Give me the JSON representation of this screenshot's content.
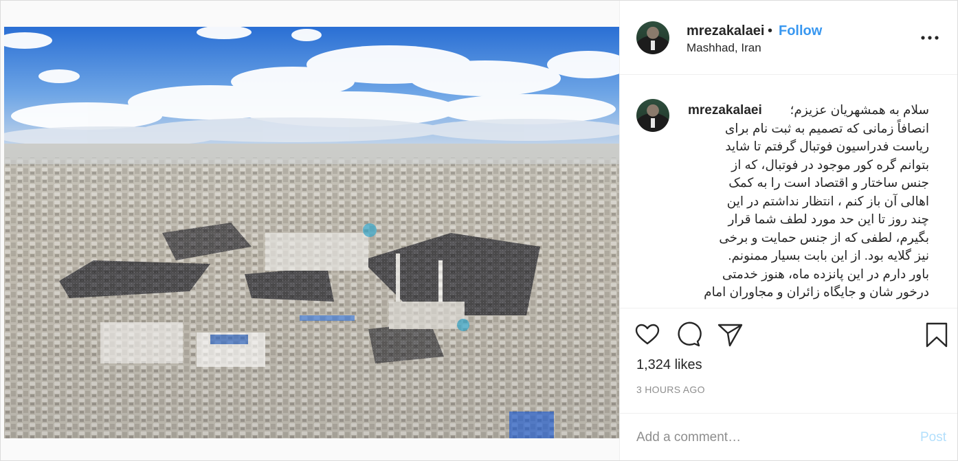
{
  "post": {
    "image_alt": "Aerial view of Mashhad",
    "author": {
      "username": "mrezakalaei",
      "separator": "•",
      "follow_label": "Follow",
      "location": "Mashhad, Iran"
    },
    "more_icon": "more-horizontal-icon",
    "caption": {
      "username": "mrezakalaei",
      "text": "سلام به همشهریان عزیزم؛\nانصافاً زمانی که تصمیم به ثبت نام برای\nریاست فدراسیون فوتبال گرفتم تا شاید\nبتوانم گره کور موجود در فوتبال، که از\nجنس ساختار و اقتصاد است را به کمک\nاهالی آن باز کنم ، انتظار نداشتم در این\nچند روز تا این حد مورد لطف شما قرار\nبگیرم، لطفی که از جنس حمایت و برخی\nنیز گلایه بود. از این بابت بسیار ممنونم.\nباور دارم در این پانزده ماه، هنوز خدمتی\nدرخور شان و جایگاه زائران و مجاوران امام"
    },
    "actions": {
      "like_icon": "heart-icon",
      "comment_icon": "comment-icon",
      "share_icon": "share-icon",
      "save_icon": "bookmark-icon"
    },
    "likes": "1,324 likes",
    "timestamp": "3 HOURS AGO",
    "comment_box": {
      "placeholder": "Add a comment…",
      "post_label": "Post"
    },
    "colors": {
      "link": "#3897f0",
      "post_disabled": "#b2dffc",
      "muted": "#8e8e8e",
      "text": "#262626"
    }
  }
}
